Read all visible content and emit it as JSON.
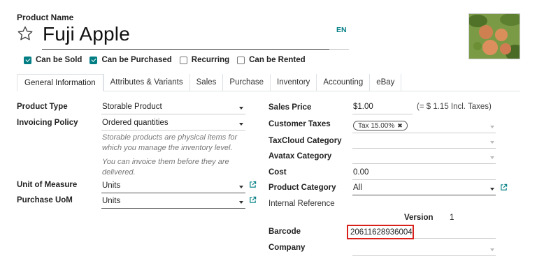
{
  "header": {
    "field_label": "Product Name",
    "product_name": "Fuji Apple",
    "language": "EN"
  },
  "options": [
    {
      "label": "Can be Sold",
      "checked": true
    },
    {
      "label": "Can be Purchased",
      "checked": true
    },
    {
      "label": "Recurring",
      "checked": false
    },
    {
      "label": "Can be Rented",
      "checked": false
    }
  ],
  "tabs": [
    "General Information",
    "Attributes & Variants",
    "Sales",
    "Purchase",
    "Inventory",
    "Accounting",
    "eBay"
  ],
  "active_tab": "General Information",
  "left": {
    "product_type": {
      "label": "Product Type",
      "value": "Storable Product"
    },
    "invoicing_policy": {
      "label": "Invoicing Policy",
      "value": "Ordered quantities"
    },
    "help_storable": "Storable products are physical items for which you manage the inventory level.",
    "help_invoice": "You can invoice them before they are delivered.",
    "uom": {
      "label": "Unit of Measure",
      "value": "Units"
    },
    "purchase_uom": {
      "label": "Purchase UoM",
      "value": "Units"
    }
  },
  "right": {
    "sales_price": {
      "label": "Sales Price",
      "value": "$1.00",
      "note": "(= $ 1.15 Incl. Taxes)"
    },
    "customer_taxes": {
      "label": "Customer Taxes",
      "tag": "Tax 15.00%"
    },
    "taxcloud_category": {
      "label": "TaxCloud Category"
    },
    "avatax_category": {
      "label": "Avatax Category"
    },
    "cost": {
      "label": "Cost",
      "value": "0.00"
    },
    "product_category": {
      "label": "Product Category",
      "value": "All"
    },
    "internal_reference": {
      "label": "Internal Reference"
    },
    "version": {
      "label": "Version",
      "value": "1"
    },
    "barcode": {
      "label": "Barcode",
      "value": "20611628936004"
    },
    "company": {
      "label": "Company"
    }
  },
  "colors": {
    "accent": "#017e84",
    "highlight": "#d9211b"
  }
}
